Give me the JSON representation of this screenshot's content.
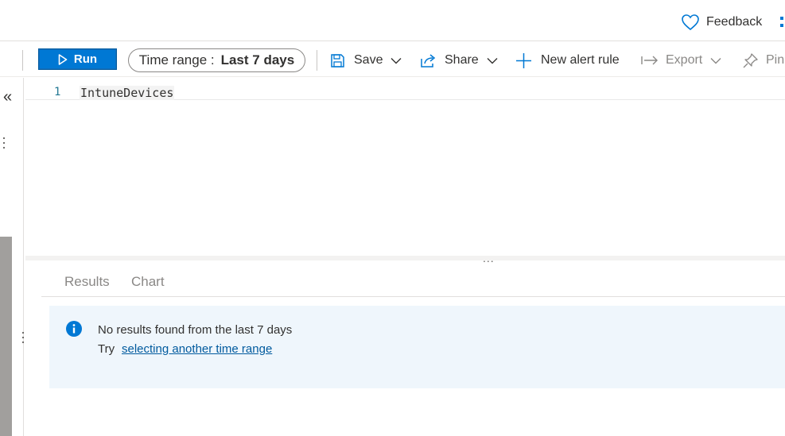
{
  "header": {
    "feedback_label": "Feedback"
  },
  "toolbar": {
    "run_label": "Run",
    "time_range_label": "Time range :",
    "time_range_value": "Last 7 days",
    "save_label": "Save",
    "share_label": "Share",
    "new_alert_label": "New alert rule",
    "export_label": "Export",
    "pin_label": "Pin"
  },
  "rail": {
    "collapse_glyph": "«"
  },
  "editor": {
    "line_number": "1",
    "code": "IntuneDevices"
  },
  "splitter": {
    "handle_glyph": "..."
  },
  "results": {
    "tabs": [
      {
        "label": "Results"
      },
      {
        "label": "Chart"
      }
    ],
    "message": "No results found from the last 7 days",
    "try_label": "Try",
    "link_label": "selecting another time range"
  },
  "colors": {
    "accent": "#0078d4",
    "info_bg": "#eff6fc",
    "link": "#005a9e",
    "disabled": "#8a8886"
  },
  "icons": {
    "feedback": "heart-icon",
    "run": "play-icon",
    "save": "save-icon",
    "share": "share-icon",
    "new_alert": "plus-icon",
    "export": "export-arrow-icon",
    "pin": "pin-icon",
    "info": "info-icon"
  }
}
